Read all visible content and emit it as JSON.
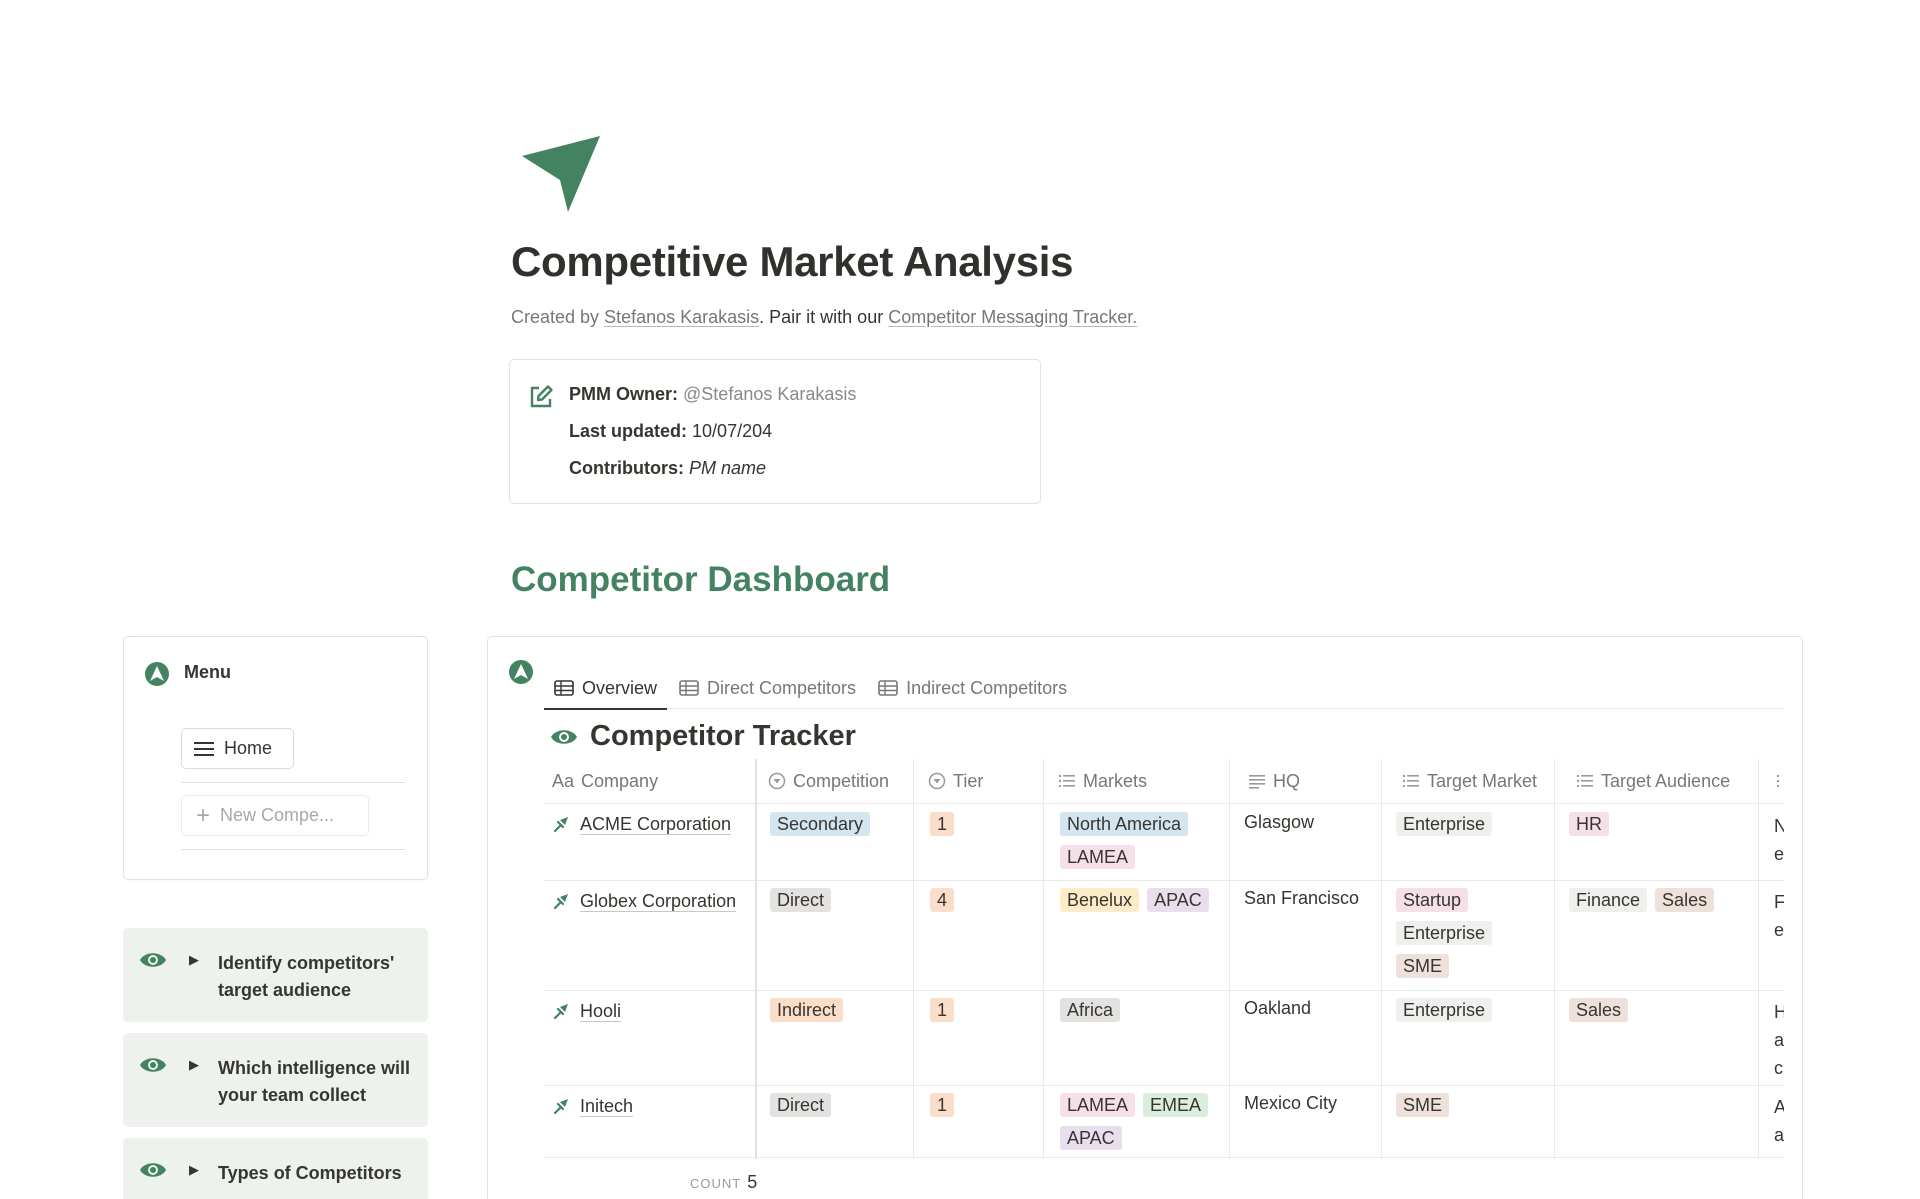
{
  "page": {
    "icon": "arrow-pointer-icon",
    "title": "Competitive Market Analysis",
    "byline": {
      "prefix": "Created by ",
      "author": "Stefanos Karakasis",
      "middle": ". Pair it with our ",
      "link": "Competitor Messaging Tracker."
    }
  },
  "callout": {
    "icon": "edit-square-icon",
    "owner_label": "PMM Owner:",
    "owner_value": "@Stefanos Karakasis",
    "updated_label": "Last updated:",
    "updated_value": "10/07/204",
    "contributors_label": "Contributors:",
    "contributors_value": "PM name"
  },
  "dashboard_heading": "Competitor Dashboard",
  "menu": {
    "title": "Menu",
    "home_label": "Home",
    "new_label": "New Compe..."
  },
  "toggles": [
    {
      "text": "Identify competitors' target audience"
    },
    {
      "text": "Which intelligence will your team collect"
    },
    {
      "text": "Types of Competitors"
    }
  ],
  "database": {
    "tabs": [
      {
        "label": "Overview",
        "active": true
      },
      {
        "label": "Direct Competitors",
        "active": false
      },
      {
        "label": "Indirect Competitors",
        "active": false
      }
    ],
    "view_title": "Competitor Tracker",
    "columns": [
      "Company",
      "Competition",
      "Tier",
      "Markets",
      "HQ",
      "Target Market",
      "Target Audience"
    ],
    "rows": [
      {
        "company": "ACME Corporation",
        "competition": "Secondary",
        "tier": "1",
        "markets": [
          "North America",
          "LAMEA"
        ],
        "hq": "Glasgow",
        "target_market": [
          "Enterprise"
        ],
        "target_audience": [
          "HR"
        ],
        "extra": [
          "N",
          "e"
        ]
      },
      {
        "company": "Globex Corporation",
        "competition": "Direct",
        "tier": "4",
        "markets": [
          "Benelux",
          "APAC"
        ],
        "hq": "San Francisco",
        "target_market": [
          "Startup",
          "Enterprise",
          "SME"
        ],
        "target_audience": [
          "Finance",
          "Sales"
        ],
        "extra": [
          "F",
          "e"
        ]
      },
      {
        "company": "Hooli",
        "competition": "Indirect",
        "tier": "1",
        "markets": [
          "Africa"
        ],
        "hq": "Oakland",
        "target_market": [
          "Enterprise"
        ],
        "target_audience": [
          "Sales"
        ],
        "extra": [
          "H",
          "a",
          "c"
        ]
      },
      {
        "company": "Initech",
        "competition": "Direct",
        "tier": "1",
        "markets": [
          "LAMEA",
          "EMEA",
          "APAC"
        ],
        "hq": "Mexico City",
        "target_market": [
          "SME"
        ],
        "target_audience": [],
        "extra": [
          "A",
          "a"
        ]
      }
    ],
    "count_label": "COUNT",
    "count_value": "5"
  },
  "colors": {
    "accent_green": "#448361",
    "toggle_bg": "#edf3ec",
    "tag_blue": "#d3e5ef",
    "tag_gray": "#e3e2e0",
    "tag_orange": "#fadec9",
    "tag_yellow": "#fdecc8",
    "tag_purple": "#e8deee",
    "tag_pink": "#f5e0e9",
    "tag_green": "#dbeddb",
    "tag_brown": "#eee0da",
    "tag_default": "#efefed"
  }
}
